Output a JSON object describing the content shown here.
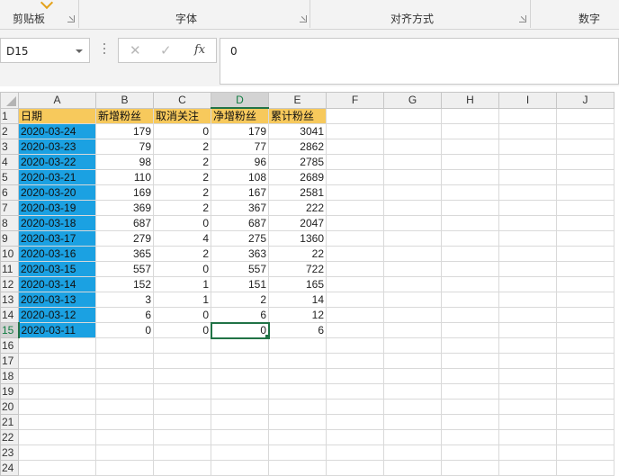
{
  "ribbon": {
    "groups": [
      "剪贴板",
      "字体",
      "对齐方式",
      "数字"
    ]
  },
  "formula_bar": {
    "name_box": "D15",
    "cancel_icon": "✕",
    "enter_icon": "✓",
    "fx_label": "fx",
    "value": "0"
  },
  "sheet": {
    "columns": [
      "A",
      "B",
      "C",
      "D",
      "E",
      "F",
      "G",
      "H",
      "I",
      "J"
    ],
    "row_numbers": [
      "1",
      "2",
      "3",
      "4",
      "5",
      "6",
      "7",
      "8",
      "9",
      "10",
      "11",
      "12",
      "13",
      "14",
      "15",
      "16",
      "17",
      "18",
      "19",
      "20",
      "21",
      "22",
      "23",
      "24"
    ],
    "headers": [
      "日期",
      "新增粉丝",
      "取消关注",
      "净增粉丝",
      "累计粉丝"
    ],
    "rows": [
      [
        "2020-03-24",
        "179",
        "0",
        "179",
        "3041"
      ],
      [
        "2020-03-23",
        "79",
        "2",
        "77",
        "2862"
      ],
      [
        "2020-03-22",
        "98",
        "2",
        "96",
        "2785"
      ],
      [
        "2020-03-21",
        "110",
        "2",
        "108",
        "2689"
      ],
      [
        "2020-03-20",
        "169",
        "2",
        "167",
        "2581"
      ],
      [
        "2020-03-19",
        "369",
        "2",
        "367",
        "222"
      ],
      [
        "2020-03-18",
        "687",
        "0",
        "687",
        "2047"
      ],
      [
        "2020-03-17",
        "279",
        "4",
        "275",
        "1360"
      ],
      [
        "2020-03-16",
        "365",
        "2",
        "363",
        "22"
      ],
      [
        "2020-03-15",
        "557",
        "0",
        "557",
        "722"
      ],
      [
        "2020-03-14",
        "152",
        "1",
        "151",
        "165"
      ],
      [
        "2020-03-13",
        "3",
        "1",
        "2",
        "14"
      ],
      [
        "2020-03-12",
        "6",
        "0",
        "6",
        "12"
      ],
      [
        "2020-03-11",
        "0",
        "0",
        "0",
        "6"
      ]
    ],
    "active_cell": "D15",
    "colors": {
      "date_fill": "#1ba1e2",
      "header_fill": "#f7c95c",
      "selection": "#217346"
    }
  }
}
